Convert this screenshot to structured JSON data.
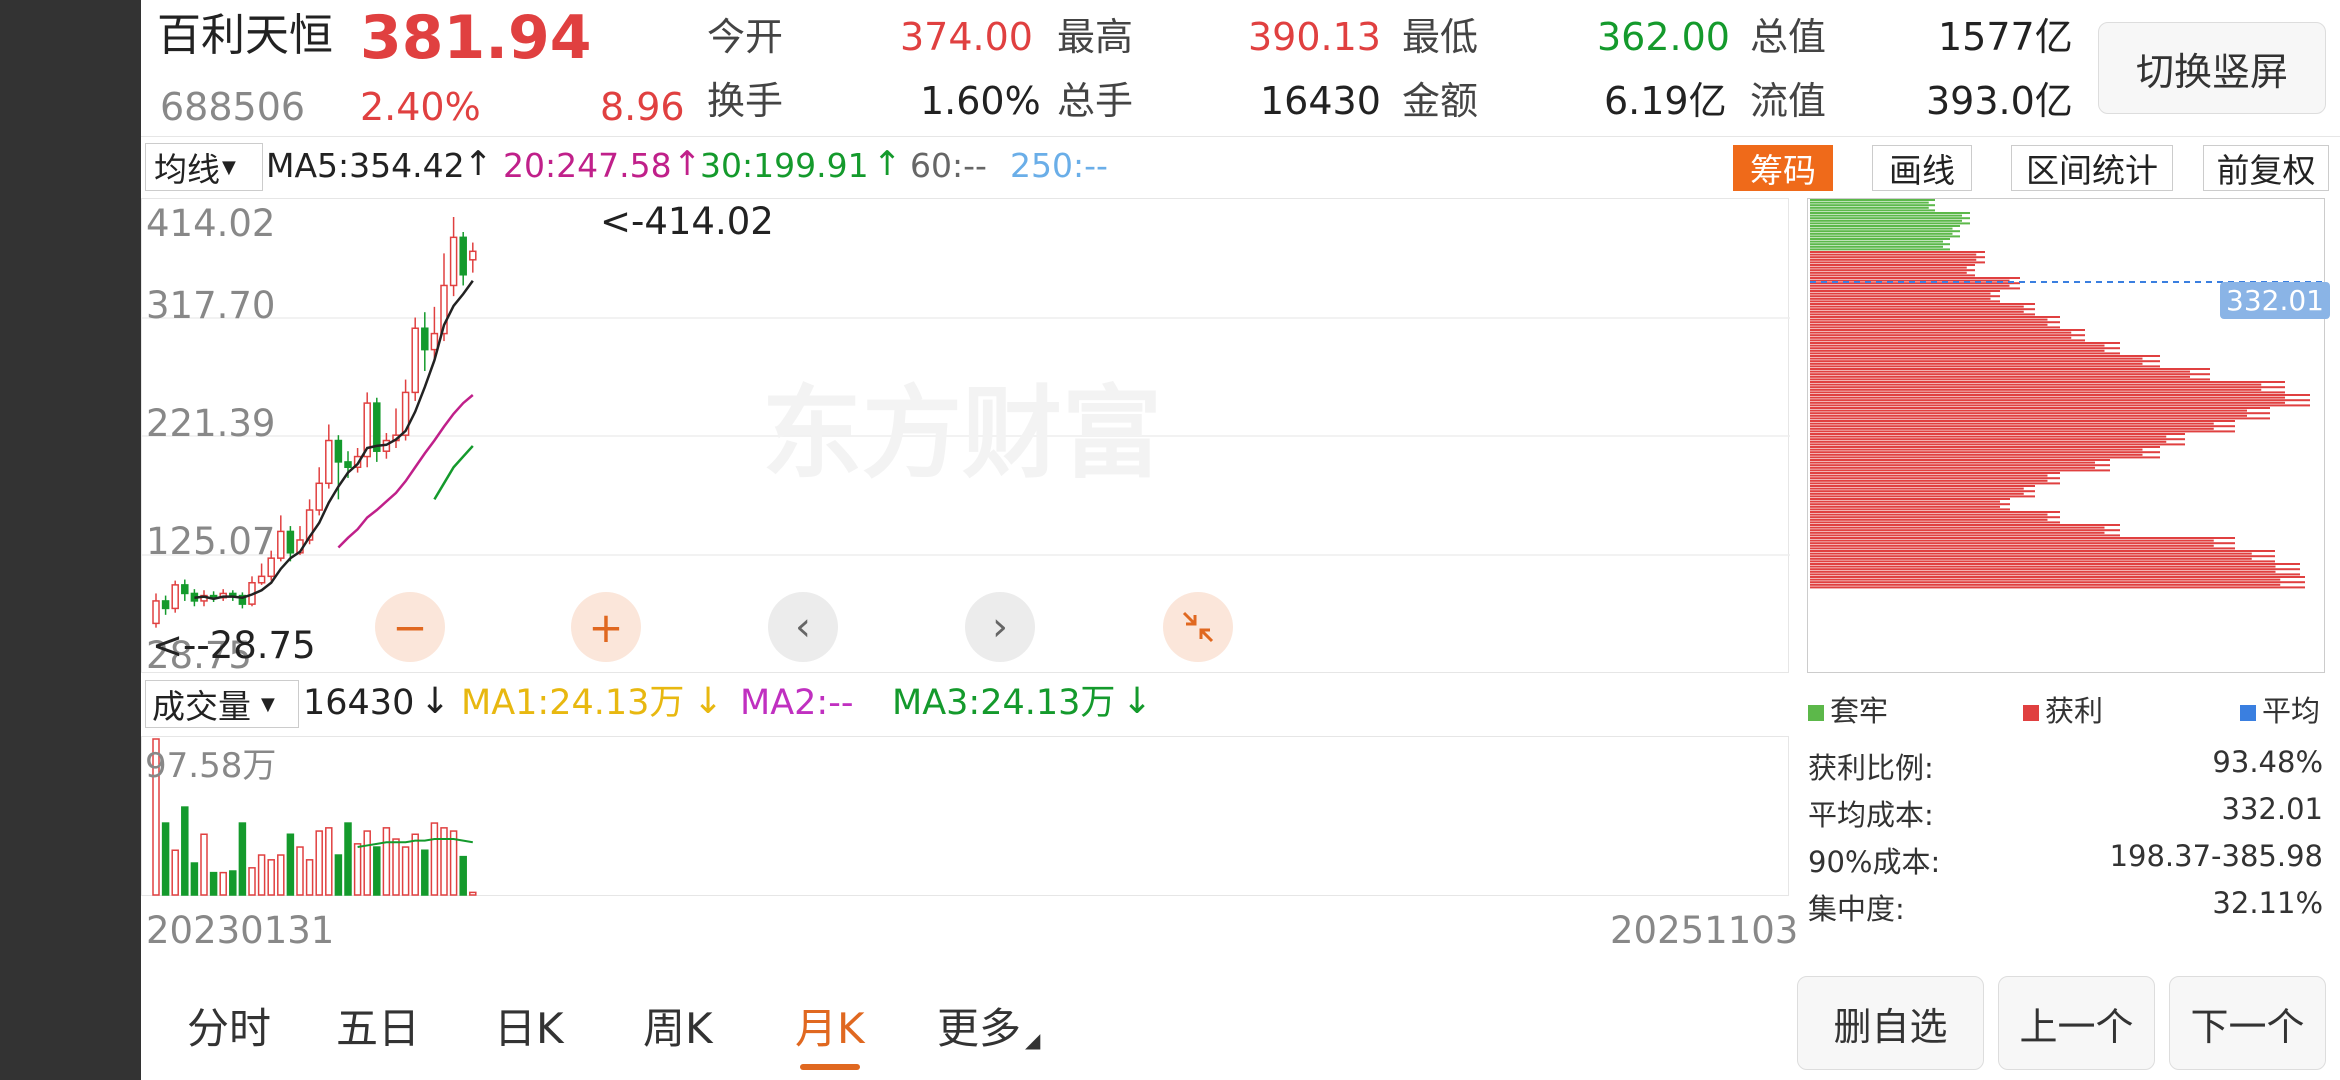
{
  "header": {
    "name": "百利天恒",
    "price": "381.94",
    "code": "688506",
    "change_pct": "2.40%",
    "change_amt": "8.96",
    "open_label": "今开",
    "open": "374.00",
    "high_label": "最高",
    "high": "390.13",
    "low_label": "最低",
    "low": "362.00",
    "mktcap_label": "总值",
    "mktcap": "1577亿",
    "turnover_label": "换手",
    "turnover": "1.60%",
    "vol_label": "总手",
    "vol": "16430",
    "amount_label": "金额",
    "amount": "6.19亿",
    "float_label": "流值",
    "float": "393.0亿",
    "switch_label": "切换竖屏"
  },
  "ma_bar": {
    "selector": "均线",
    "ma5": "MA5:354.42",
    "ma20": "20:247.58",
    "ma30": "30:199.91",
    "ma60": "60:--",
    "ma250": "250:--"
  },
  "toolbar": {
    "chips": "筹码",
    "draw": "画线",
    "range_stats": "区间统计",
    "adjust": "前复权"
  },
  "price_axis": [
    "414.02",
    "317.70",
    "221.39",
    "125.07",
    "28.75"
  ],
  "annotations": {
    "max": "<-414.02",
    "min": "<--28.75"
  },
  "watermark": "东方财富",
  "volume_bar": {
    "selector": "成交量",
    "value": "16430",
    "ma1": "MA1:24.13万",
    "ma2": "MA2:--",
    "ma3": "MA3:24.13万",
    "axis_max": "97.58万"
  },
  "dates": {
    "start": "20230131",
    "end": "20251103"
  },
  "chips_panel": {
    "avg_cost_tag": "332.01",
    "legend": [
      "套牢",
      "获利",
      "平均"
    ],
    "stats": [
      {
        "label": "获利比例:",
        "value": "93.48%"
      },
      {
        "label": "平均成本:",
        "value": "332.01"
      },
      {
        "label": "90%成本:",
        "value": "198.37-385.98"
      },
      {
        "label": "集中度:",
        "value": "32.11%"
      }
    ]
  },
  "tabs": [
    "分时",
    "五日",
    "日K",
    "周K",
    "月K",
    "更多"
  ],
  "active_tab": "月K",
  "bottom_buttons": {
    "remove": "删自选",
    "prev": "上一个",
    "next": "下一个"
  },
  "colors": {
    "up": "#e04040",
    "down": "#149a2c",
    "ma20": "#c0208a",
    "ma30": "#149a2c",
    "ma250": "#6aaee8",
    "accent": "#ef6a1a"
  },
  "chart_data": {
    "type": "candlestick",
    "period": "monthly",
    "ylim": [
      28.75,
      414.02
    ],
    "candles": [
      {
        "o": 34,
        "c": 55,
        "h": 62,
        "l": 30
      },
      {
        "o": 55,
        "c": 48,
        "h": 60,
        "l": 42
      },
      {
        "o": 48,
        "c": 70,
        "h": 74,
        "l": 44
      },
      {
        "o": 70,
        "c": 62,
        "h": 75,
        "l": 55
      },
      {
        "o": 62,
        "c": 55,
        "h": 66,
        "l": 50
      },
      {
        "o": 55,
        "c": 60,
        "h": 65,
        "l": 50
      },
      {
        "o": 60,
        "c": 58,
        "h": 64,
        "l": 54
      },
      {
        "o": 58,
        "c": 62,
        "h": 66,
        "l": 55
      },
      {
        "o": 62,
        "c": 60,
        "h": 65,
        "l": 55
      },
      {
        "o": 60,
        "c": 52,
        "h": 63,
        "l": 48
      },
      {
        "o": 52,
        "c": 72,
        "h": 78,
        "l": 50
      },
      {
        "o": 72,
        "c": 78,
        "h": 90,
        "l": 70
      },
      {
        "o": 78,
        "c": 95,
        "h": 102,
        "l": 74
      },
      {
        "o": 95,
        "c": 120,
        "h": 135,
        "l": 92
      },
      {
        "o": 120,
        "c": 100,
        "h": 125,
        "l": 92
      },
      {
        "o": 100,
        "c": 112,
        "h": 125,
        "l": 98
      },
      {
        "o": 112,
        "c": 140,
        "h": 150,
        "l": 108
      },
      {
        "o": 140,
        "c": 165,
        "h": 180,
        "l": 135
      },
      {
        "o": 165,
        "c": 205,
        "h": 220,
        "l": 160
      },
      {
        "o": 205,
        "c": 185,
        "h": 210,
        "l": 150
      },
      {
        "o": 185,
        "c": 180,
        "h": 195,
        "l": 170
      },
      {
        "o": 180,
        "c": 190,
        "h": 198,
        "l": 175
      },
      {
        "o": 190,
        "c": 240,
        "h": 250,
        "l": 180
      },
      {
        "o": 240,
        "c": 195,
        "h": 245,
        "l": 185
      },
      {
        "o": 195,
        "c": 205,
        "h": 212,
        "l": 188
      },
      {
        "o": 205,
        "c": 210,
        "h": 235,
        "l": 198
      },
      {
        "o": 210,
        "c": 250,
        "h": 262,
        "l": 205
      },
      {
        "o": 250,
        "c": 310,
        "h": 320,
        "l": 242
      },
      {
        "o": 310,
        "c": 290,
        "h": 325,
        "l": 270
      },
      {
        "o": 290,
        "c": 305,
        "h": 330,
        "l": 282
      },
      {
        "o": 305,
        "c": 350,
        "h": 380,
        "l": 298
      },
      {
        "o": 350,
        "c": 395,
        "h": 414.02,
        "l": 340
      },
      {
        "o": 395,
        "c": 360,
        "h": 400,
        "l": 350
      },
      {
        "o": 374,
        "c": 381.94,
        "h": 390.13,
        "l": 362
      }
    ],
    "ma5": [
      null,
      null,
      null,
      null,
      58,
      59,
      57,
      59,
      59,
      58,
      61,
      65,
      72,
      85,
      95,
      101,
      115,
      128,
      147,
      162,
      175,
      183,
      198,
      200,
      201,
      206,
      214,
      232,
      255,
      280,
      313,
      331,
      342,
      354.42
    ],
    "ma20": [
      null,
      null,
      null,
      null,
      null,
      null,
      null,
      null,
      null,
      null,
      null,
      null,
      null,
      null,
      null,
      null,
      null,
      null,
      null,
      105,
      114,
      122,
      133,
      140,
      148,
      156,
      167,
      180,
      193,
      205,
      218,
      230,
      240,
      247.58
    ],
    "ma30": [
      null,
      null,
      null,
      null,
      null,
      null,
      null,
      null,
      null,
      null,
      null,
      null,
      null,
      null,
      null,
      null,
      null,
      null,
      null,
      null,
      null,
      null,
      null,
      null,
      null,
      null,
      null,
      null,
      null,
      150,
      165,
      180,
      190,
      199.91
    ],
    "volume": [
      97.58,
      45,
      28,
      55,
      20,
      38,
      14,
      14,
      15,
      45,
      17,
      25,
      22,
      25,
      38,
      30,
      22,
      40,
      42,
      25,
      45,
      32,
      40,
      30,
      42,
      35,
      30,
      38,
      28,
      45,
      42,
      40,
      24,
      1.64
    ],
    "vol_ma": [
      null,
      null,
      null,
      null,
      null,
      null,
      null,
      null,
      null,
      null,
      null,
      null,
      null,
      null,
      null,
      null,
      null,
      null,
      null,
      null,
      null,
      30,
      31,
      32,
      33,
      33,
      33,
      34,
      34,
      35,
      35,
      35,
      34,
      33
    ],
    "vol_ylim": [
      0,
      97.58
    ],
    "chip_distribution": {
      "price_range": [
        28.75,
        414.02
      ],
      "trapped_bins": [
        0.25,
        0.32,
        0.3,
        0.28,
        0.35,
        0.33,
        0.42,
        0.38,
        0.45,
        0.5,
        0.55,
        0.62,
        0.7,
        0.8,
        0.95,
        1.0,
        0.92,
        0.85,
        0.75,
        0.7,
        0.6,
        0.5,
        0.45,
        0.4,
        0.5,
        0.62,
        0.85,
        0.93,
        0.98,
        0.99
      ],
      "avg_cost": 332.01
    }
  }
}
